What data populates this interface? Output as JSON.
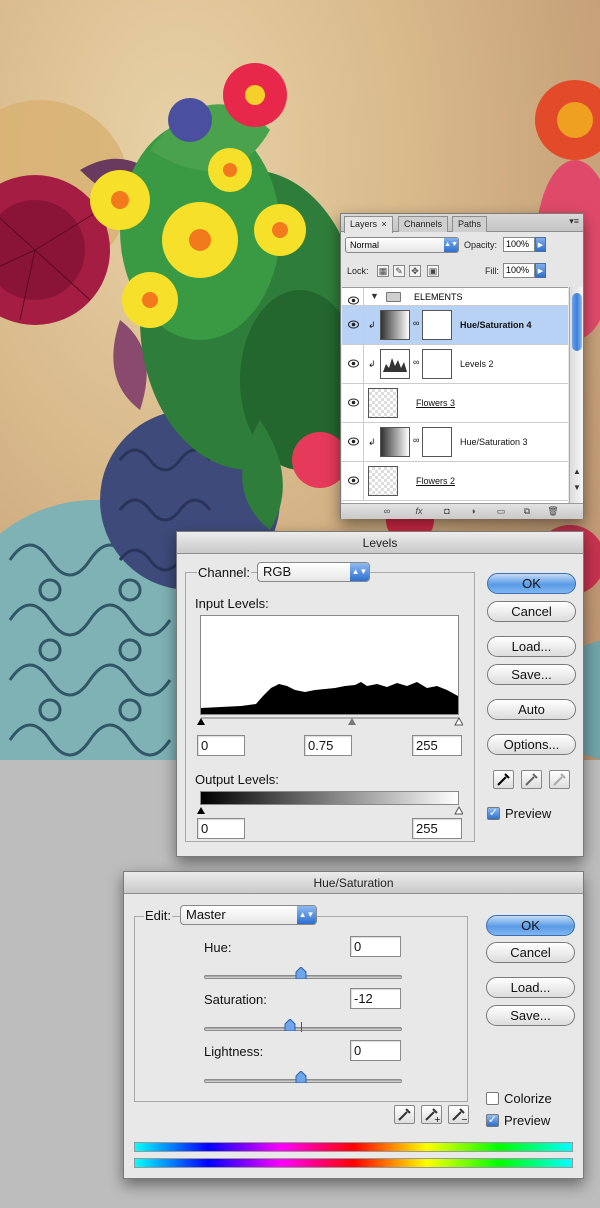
{
  "layers_panel": {
    "tabs": [
      "Layers",
      "Channels",
      "Paths"
    ],
    "tab_close": "×",
    "blend_mode": "Normal",
    "opacity_label": "Opacity:",
    "opacity_value": "100%",
    "lock_label": "Lock:",
    "fill_label": "Fill:",
    "fill_value": "100%",
    "group_name": "ELEMENTS",
    "layers": [
      {
        "name": "Hue/Saturation 4",
        "selected": true
      },
      {
        "name": "Levels 2",
        "selected": false
      },
      {
        "name": "Flowers 3",
        "selected": false
      },
      {
        "name": "Hue/Saturation 3",
        "selected": false
      },
      {
        "name": "Flowers 2",
        "selected": false
      }
    ]
  },
  "levels_dialog": {
    "title": "Levels",
    "channel_label": "Channel:",
    "channel_value": "RGB",
    "input_levels_label": "Input Levels:",
    "input_black": "0",
    "input_gamma": "0.75",
    "input_white": "255",
    "output_levels_label": "Output Levels:",
    "output_black": "0",
    "output_white": "255",
    "buttons": {
      "ok": "OK",
      "cancel": "Cancel",
      "load": "Load...",
      "save": "Save...",
      "auto": "Auto",
      "options": "Options..."
    },
    "preview_label": "Preview",
    "preview_checked": true
  },
  "hue_sat_dialog": {
    "title": "Hue/Saturation",
    "edit_label": "Edit:",
    "edit_value": "Master",
    "hue_label": "Hue:",
    "hue_value": "0",
    "saturation_label": "Saturation:",
    "saturation_value": "-12",
    "lightness_label": "Lightness:",
    "lightness_value": "0",
    "buttons": {
      "ok": "OK",
      "cancel": "Cancel",
      "load": "Load...",
      "save": "Save..."
    },
    "colorize_label": "Colorize",
    "colorize_checked": false,
    "preview_label": "Preview",
    "preview_checked": true
  },
  "colors": {
    "selected_layer": "#b8d2f6",
    "default_button": "#5a9be6",
    "teal_pattern": "#7fb2b5",
    "dialog_bg": "#e8e8e8"
  }
}
